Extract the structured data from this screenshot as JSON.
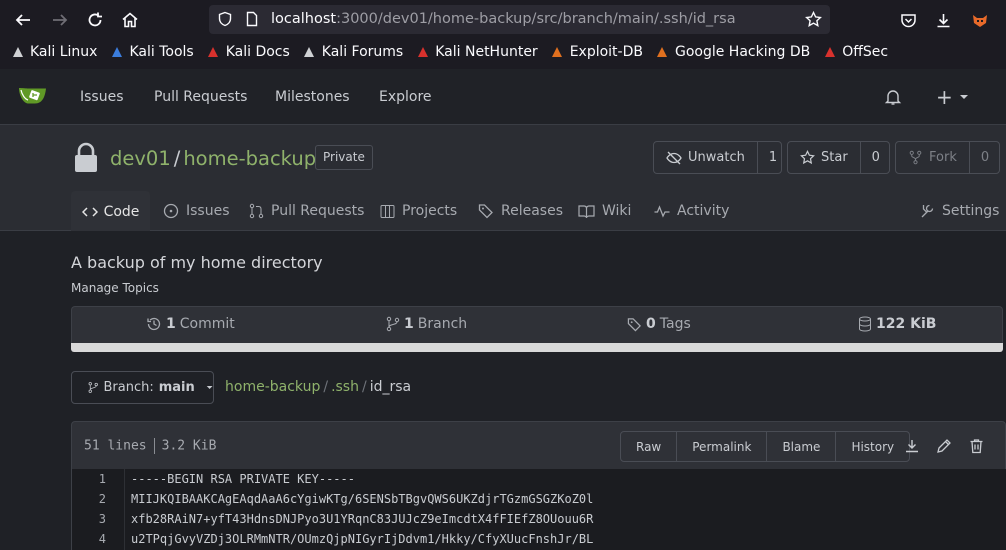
{
  "browser": {
    "url_host": "localhost",
    "url_path": ":3000/dev01/home-backup/src/branch/main/.ssh/id_rsa",
    "bookmarks": [
      {
        "label": "Kali Linux",
        "icon": "kali-icon",
        "color": "#cfd1d4"
      },
      {
        "label": "Kali Tools",
        "icon": "kali-tools-icon",
        "color": "#3b7ddd"
      },
      {
        "label": "Kali Docs",
        "icon": "kali-docs-icon",
        "color": "#d8312d"
      },
      {
        "label": "Kali Forums",
        "icon": "kali-forums-icon",
        "color": "#cfd1d4"
      },
      {
        "label": "Kali NetHunter",
        "icon": "nethunter-icon",
        "color": "#d8312d"
      },
      {
        "label": "Exploit-DB",
        "icon": "exploit-db-icon",
        "color": "#e0701f"
      },
      {
        "label": "Google Hacking DB",
        "icon": "ghdb-icon",
        "color": "#e0701f"
      },
      {
        "label": "OffSec",
        "icon": "offsec-icon",
        "color": "#d8312d"
      }
    ]
  },
  "nav": {
    "items": [
      "Issues",
      "Pull Requests",
      "Milestones",
      "Explore"
    ],
    "plus": "+"
  },
  "repo": {
    "owner": "dev01",
    "separator": "/",
    "name": "home-backup",
    "visibility": "Private",
    "unwatch_label": "Unwatch",
    "watch_count": "1",
    "star_label": "Star",
    "star_count": "0",
    "fork_label": "Fork",
    "fork_count": "0"
  },
  "tabs": {
    "code": "Code",
    "issues": "Issues",
    "pulls": "Pull Requests",
    "projects": "Projects",
    "releases": "Releases",
    "wiki": "Wiki",
    "activity": "Activity",
    "settings": "Settings"
  },
  "summary": {
    "description": "A backup of my home directory",
    "manage_topics": "Manage Topics",
    "commits_num": "1",
    "commits_label": "Commit",
    "branches_num": "1",
    "branches_label": "Branch",
    "tags_num": "0",
    "tags_label": "Tags",
    "size": "122 KiB"
  },
  "file": {
    "branch_prefix": "Branch:",
    "branch_name": "main",
    "crumbs": [
      "home-backup",
      "/",
      ".ssh",
      "/",
      "id_rsa"
    ],
    "lines_info": "51 lines",
    "size_info": "3.2 KiB",
    "buttons": [
      "Raw",
      "Permalink",
      "Blame",
      "History"
    ],
    "code_lines": [
      {
        "n": "1",
        "t": "-----BEGIN RSA PRIVATE KEY-----"
      },
      {
        "n": "2",
        "t": "MIIJKQIBAAKCAgEAqdAaA6cYgiwKTg/6SENSbTBgvQWS6UKZdjrTGzmGSGZKoZ0l"
      },
      {
        "n": "3",
        "t": "xfb28RAiN7+yfT43HdnsDNJPyo3U1YRqnC83JUJcZ9eImcdtX4fFIEfZ8OUouu6R"
      },
      {
        "n": "4",
        "t": "u2TPqjGvyVZDj3OLRMmNTR/OUmzQjpNIGyrIjDdvm1/Hkky/CfyXUucFnshJr/BL"
      }
    ]
  }
}
